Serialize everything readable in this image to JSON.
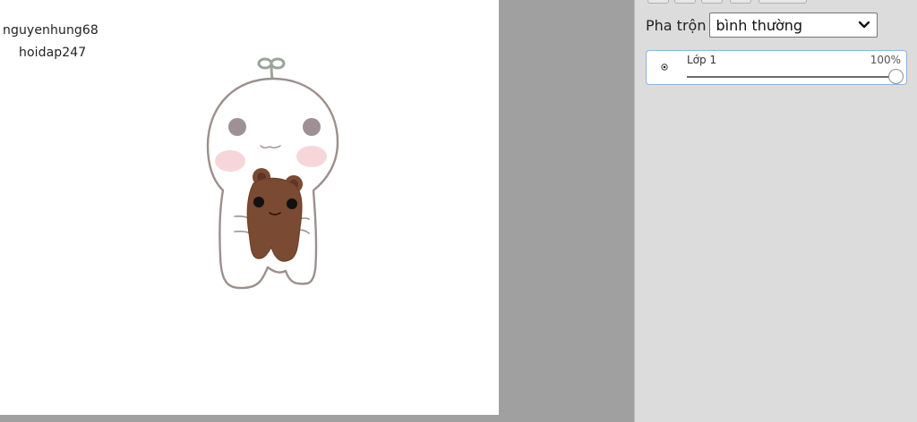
{
  "canvas": {
    "texts": [
      "nguyenhung68",
      "hoidap247"
    ]
  },
  "panel": {
    "blend": {
      "label": "Pha trộn",
      "value": "bình thường"
    },
    "layers": [
      {
        "name": "Lớp 1",
        "opacity_label": "100%",
        "opacity": 1.0,
        "visible": true
      }
    ]
  },
  "colors": {
    "canvas_bg": "#ffffff",
    "workspace_bg": "#a0a0a0",
    "panel_bg": "#dcdcdc",
    "layer_border": "#8fb4e0",
    "character_outline": "#9c8f8c",
    "cheek_pink": "#f6cfd3",
    "eye_gray": "#9e9094",
    "bear_brown": "#7a4a32"
  },
  "icons": {
    "layer_visibility": "eye-icon",
    "select_arrow": "chevron-down-icon"
  }
}
